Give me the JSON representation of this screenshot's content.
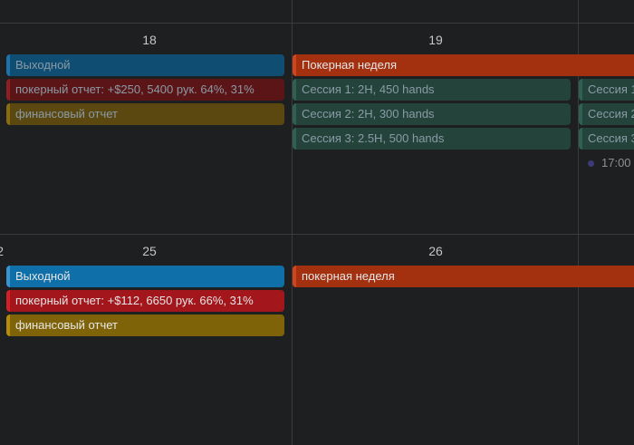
{
  "week1": {
    "day_a": "18",
    "day_b": "19",
    "day_a_events": {
      "holiday": "Выходной",
      "poker_report": "покерный отчет: +$250, 5400 рук. 64%, 31%",
      "finance_report": "финансовый отчет"
    },
    "poker_week": "Покерная неделя",
    "day_b_events": {
      "session1": "Сессия 1: 2H, 450 hands",
      "session2": "Сессия 2: 2H, 300 hands",
      "session3": "Сессия 3: 2.5H, 500 hands"
    },
    "day_c_events": {
      "session1": "Сессия 1",
      "session2": "Сессия 2",
      "session3": "Сессия 3",
      "time": "17:00"
    }
  },
  "week2": {
    "day_prev": "2",
    "day_a": "25",
    "day_b": "26",
    "day_a_events": {
      "holiday": "Выходной",
      "poker_report": "покерный отчет: +$112, 6650 рук. 66%, 31%",
      "finance_report": "финансовый отчет"
    },
    "poker_week": "покерная неделя"
  },
  "colors": {
    "holiday_past": "#0f4d73",
    "holiday_past_stripe": "#1b73a8",
    "holiday": "#0f6fa8",
    "holiday_stripe": "#3a93cf",
    "poker_past": "#5c1517",
    "poker_past_stripe": "#8e2024",
    "poker": "#a3161b",
    "poker_stripe": "#d32027",
    "finance_past": "#5a4810",
    "finance_past_stripe": "#8a6c10",
    "finance": "#7f6308",
    "finance_stripe": "#b58c08",
    "poker_week": "#a3300f",
    "poker_week_stripe": "#d0451b",
    "session_past": "#24443b",
    "session_past_stripe": "#2e6152",
    "text_past": "#8a9aa6",
    "text": "#e6e6e6"
  }
}
